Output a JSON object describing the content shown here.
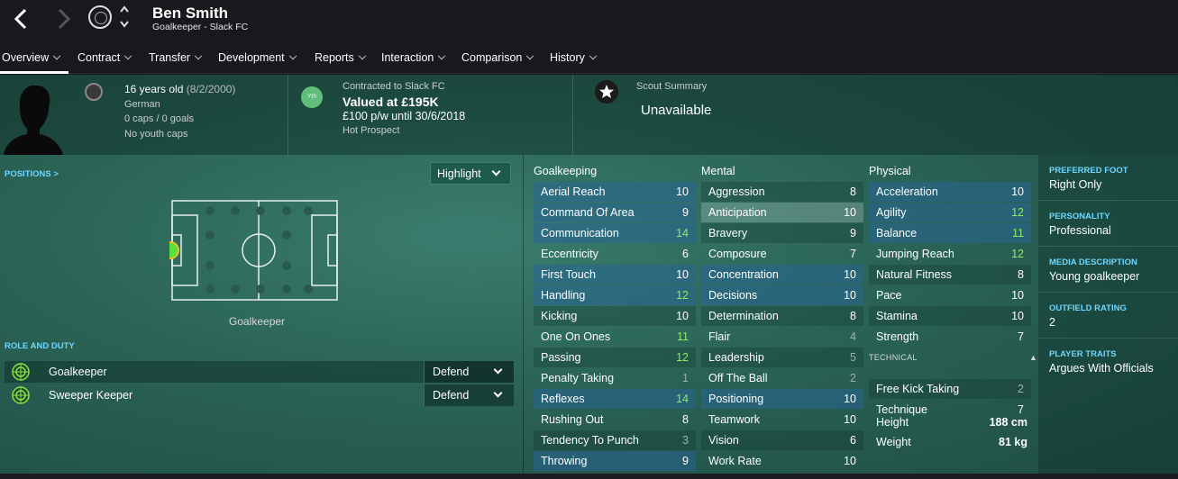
{
  "player": {
    "name": "Ben Smith",
    "role_club": "Goalkeeper - Slack FC"
  },
  "tabs": [
    {
      "label": "Overview"
    },
    {
      "label": "Contract"
    },
    {
      "label": "Transfer"
    },
    {
      "label": "Development"
    },
    {
      "label": "Reports"
    },
    {
      "label": "Interaction"
    },
    {
      "label": "Comparison"
    },
    {
      "label": "History"
    }
  ],
  "active_tab": "Overview",
  "info": {
    "age": "16 years old",
    "dob": "(8/2/2000)",
    "nationality": "German",
    "caps": "0 caps / 0 goals",
    "youth_caps": "No youth caps"
  },
  "contract": {
    "badge": "Yth",
    "contracted": "Contracted to Slack FC",
    "valued": "Valued at £195K",
    "wage": "£100 p/w until 30/6/2018",
    "prospect": "Hot Prospect"
  },
  "scout": {
    "label": "Scout Summary",
    "value": "Unavailable"
  },
  "positions": {
    "label": "POSITIONS >",
    "highlight": "Highlight",
    "position_name": "Goalkeeper"
  },
  "roles": {
    "label": "ROLE AND DUTY",
    "items": [
      {
        "name": "Goalkeeper",
        "duty": "Defend"
      },
      {
        "name": "Sweeper Keeper",
        "duty": "Defend"
      }
    ]
  },
  "attributes": {
    "goalkeeping": {
      "title": "Goalkeeping",
      "items": [
        {
          "name": "Aerial Reach",
          "value": "10"
        },
        {
          "name": "Command Of Area",
          "value": "9"
        },
        {
          "name": "Communication",
          "value": "14"
        },
        {
          "name": "Eccentricity",
          "value": "6"
        },
        {
          "name": "First Touch",
          "value": "10"
        },
        {
          "name": "Handling",
          "value": "12"
        },
        {
          "name": "Kicking",
          "value": "10"
        },
        {
          "name": "One On Ones",
          "value": "11"
        },
        {
          "name": "Passing",
          "value": "12"
        },
        {
          "name": "Penalty Taking",
          "value": "1"
        },
        {
          "name": "Reflexes",
          "value": "14"
        },
        {
          "name": "Rushing Out",
          "value": "8"
        },
        {
          "name": "Tendency To Punch",
          "value": "3"
        },
        {
          "name": "Throwing",
          "value": "9"
        }
      ]
    },
    "mental": {
      "title": "Mental",
      "items": [
        {
          "name": "Aggression",
          "value": "8"
        },
        {
          "name": "Anticipation",
          "value": "10"
        },
        {
          "name": "Bravery",
          "value": "9"
        },
        {
          "name": "Composure",
          "value": "7"
        },
        {
          "name": "Concentration",
          "value": "10"
        },
        {
          "name": "Decisions",
          "value": "10"
        },
        {
          "name": "Determination",
          "value": "8"
        },
        {
          "name": "Flair",
          "value": "4"
        },
        {
          "name": "Leadership",
          "value": "5"
        },
        {
          "name": "Off The Ball",
          "value": "2"
        },
        {
          "name": "Positioning",
          "value": "10"
        },
        {
          "name": "Teamwork",
          "value": "10"
        },
        {
          "name": "Vision",
          "value": "6"
        },
        {
          "name": "Work Rate",
          "value": "10"
        }
      ]
    },
    "physical": {
      "title": "Physical",
      "items": [
        {
          "name": "Acceleration",
          "value": "10"
        },
        {
          "name": "Agility",
          "value": "12"
        },
        {
          "name": "Balance",
          "value": "11"
        },
        {
          "name": "Jumping Reach",
          "value": "12"
        },
        {
          "name": "Natural Fitness",
          "value": "8"
        },
        {
          "name": "Pace",
          "value": "10"
        },
        {
          "name": "Stamina",
          "value": "10"
        },
        {
          "name": "Strength",
          "value": "7"
        }
      ]
    },
    "technical": {
      "title": "TECHNICAL",
      "caret": "▲",
      "items": [
        {
          "name": "Free Kick Taking",
          "value": "2"
        },
        {
          "name": "Technique",
          "value": "7"
        }
      ]
    },
    "height": {
      "name": "Height",
      "value": "188 cm"
    },
    "weight": {
      "name": "Weight",
      "value": "81 kg"
    }
  },
  "side": {
    "foot_label": "PREFERRED FOOT",
    "foot": "Right Only",
    "personality_label": "PERSONALITY",
    "personality": "Professional",
    "media_label": "MEDIA DESCRIPTION",
    "media": "Young goalkeeper",
    "outfield_label": "OUTFIELD RATING",
    "outfield": "2",
    "traits_label": "PLAYER TRAITS",
    "traits": "Argues With Officials"
  },
  "colors": {
    "accent": "#6ed6ff",
    "high_value": "#8fea6a",
    "pitch_bg": "#2a6355"
  }
}
